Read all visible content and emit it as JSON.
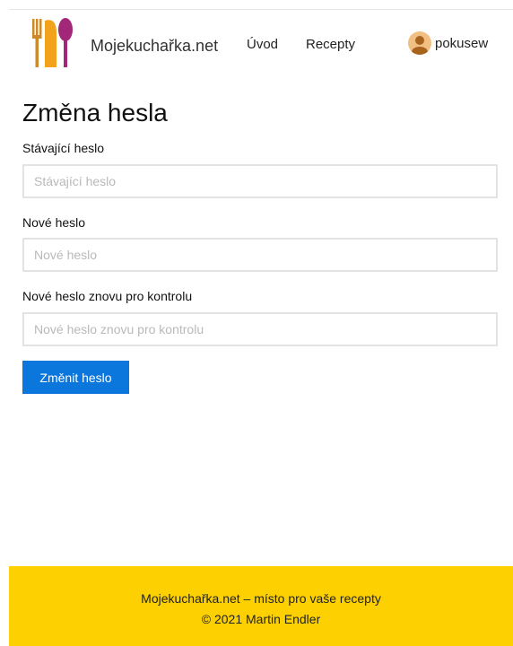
{
  "header": {
    "brand": "Mojekuchařka.net",
    "nav": [
      {
        "label": "Úvod"
      },
      {
        "label": "Recepty"
      }
    ],
    "user": {
      "name": "pokusew"
    },
    "icons": {
      "logo": "utensils-logo-icon",
      "avatar": "user-avatar-icon"
    },
    "colors": {
      "fork": "#cc8a2a",
      "knife": "#f2a21b",
      "spoon": "#a32779"
    }
  },
  "page": {
    "title": "Změna hesla"
  },
  "form": {
    "current": {
      "label": "Stávající heslo",
      "placeholder": "Stávající heslo",
      "value": ""
    },
    "new": {
      "label": "Nové heslo",
      "placeholder": "Nové heslo",
      "value": ""
    },
    "confirm": {
      "label": "Nové heslo znovu pro kontrolu",
      "placeholder": "Nové heslo znovu pro kontrolu",
      "value": ""
    },
    "submit_label": "Změnit heslo",
    "submit_color": "#0b76db"
  },
  "footer": {
    "line1": "Mojekuchařka.net – místo pro vaše recepty",
    "line2": "© 2021 Martin Endler",
    "background": "#fdd101"
  }
}
